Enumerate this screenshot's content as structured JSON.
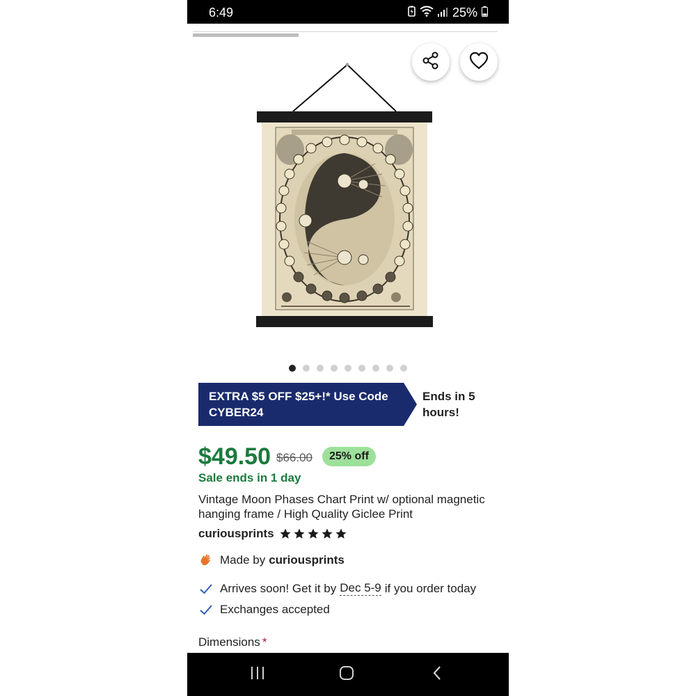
{
  "status_bar": {
    "time": "6:49",
    "battery_percent": "25%",
    "icons": [
      "battery-saver-icon",
      "wifi-icon",
      "signal-icon",
      "battery-icon"
    ]
  },
  "image_gallery": {
    "current_index": 1,
    "total_images": 9,
    "share_icon": "share-icon",
    "favorite_icon": "heart-icon"
  },
  "promo": {
    "text": "EXTRA $5 OFF $25+!* Use Code CYBER24",
    "ends": "Ends in 5 hours!",
    "color": "#1a2b6d"
  },
  "product": {
    "price": "$49.50",
    "original_price": "$66.00",
    "discount": "25% off",
    "sale_ends": "Sale ends in 1 day",
    "title": "Vintage Moon Phases Chart Print w/ optional magnetic hanging frame / High Quality Giclee Print",
    "shop_name": "curiousprints",
    "rating_stars": 5,
    "made_by_label": "Made by",
    "made_by_shop": "curiousprints",
    "arrives_prefix": "Arrives soon! Get it by",
    "arrives_date": "Dec 5-9",
    "arrives_suffix": "if you order today",
    "exchanges": "Exchanges accepted",
    "dimensions_label": "Dimensions",
    "required_marker": "*",
    "price_color": "#1c7a3e",
    "discount_bg": "#9de09a"
  },
  "nav_bar": {
    "buttons": [
      "recents-icon",
      "home-icon",
      "back-icon"
    ]
  }
}
